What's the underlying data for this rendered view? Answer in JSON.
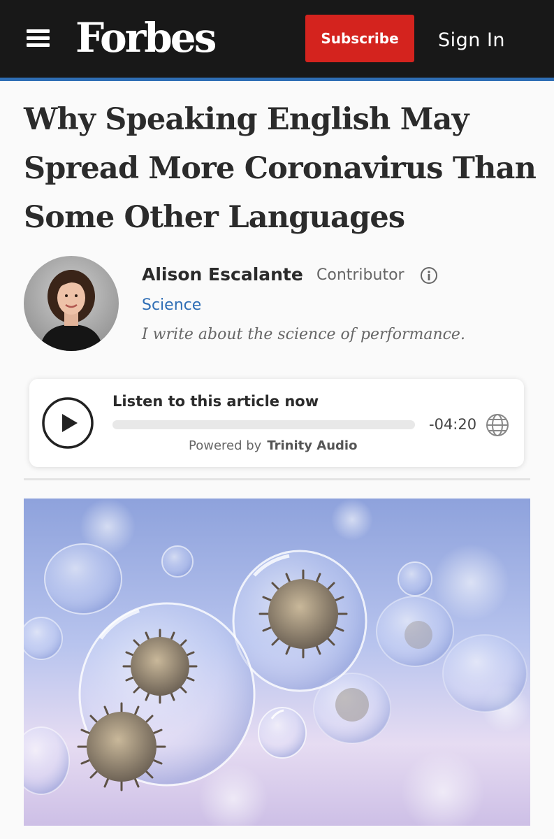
{
  "header": {
    "logo": "Forbes",
    "subscribe_label": "Subscribe",
    "signin_label": "Sign In",
    "bg_color": "#181818",
    "accent_color": "#2f6eb5",
    "subscribe_color": "#d4231e"
  },
  "article": {
    "headline_lines": [
      "Why Speaking English May",
      "Spread More Coronavirus Than",
      "Some Other Languages"
    ],
    "author": {
      "name": "Alison Escalante",
      "role": "Contributor",
      "section": "Science",
      "bio": "I write about the science of performance."
    }
  },
  "audio": {
    "title": "Listen to this article now",
    "time": "-04:20",
    "powered_by": "Powered by",
    "provider": "Trinity Audio",
    "progress": 0
  },
  "icons": {
    "menu": "hamburger-menu-icon",
    "info": "info-icon",
    "play": "play-icon",
    "language": "globe-icon"
  }
}
